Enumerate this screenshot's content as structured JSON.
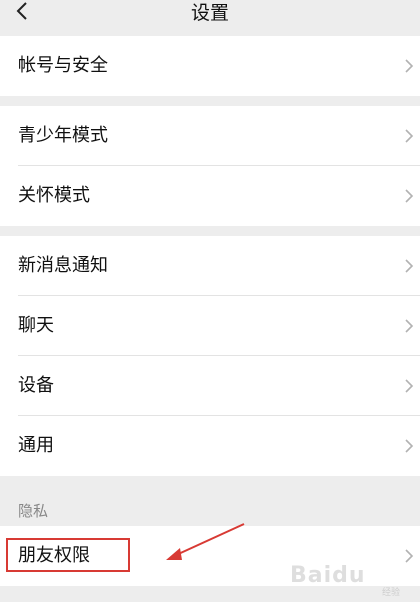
{
  "header": {
    "title": "设置"
  },
  "groups": [
    {
      "items": [
        {
          "label": "帐号与安全"
        }
      ]
    },
    {
      "items": [
        {
          "label": "青少年模式"
        },
        {
          "label": "关怀模式"
        }
      ]
    },
    {
      "items": [
        {
          "label": "新消息通知"
        },
        {
          "label": "聊天"
        },
        {
          "label": "设备"
        },
        {
          "label": "通用"
        }
      ]
    }
  ],
  "privacy": {
    "section_label": "隐私",
    "items": [
      {
        "label": "朋友权限"
      }
    ]
  },
  "icons": {
    "back": "chevron-left-icon",
    "row_chevron": "chevron-right-icon"
  },
  "colors": {
    "background": "#ededed",
    "row_background": "#ffffff",
    "annotation": "#d83a34"
  },
  "watermark": {
    "brand": "Baidu",
    "sub": "经验"
  }
}
